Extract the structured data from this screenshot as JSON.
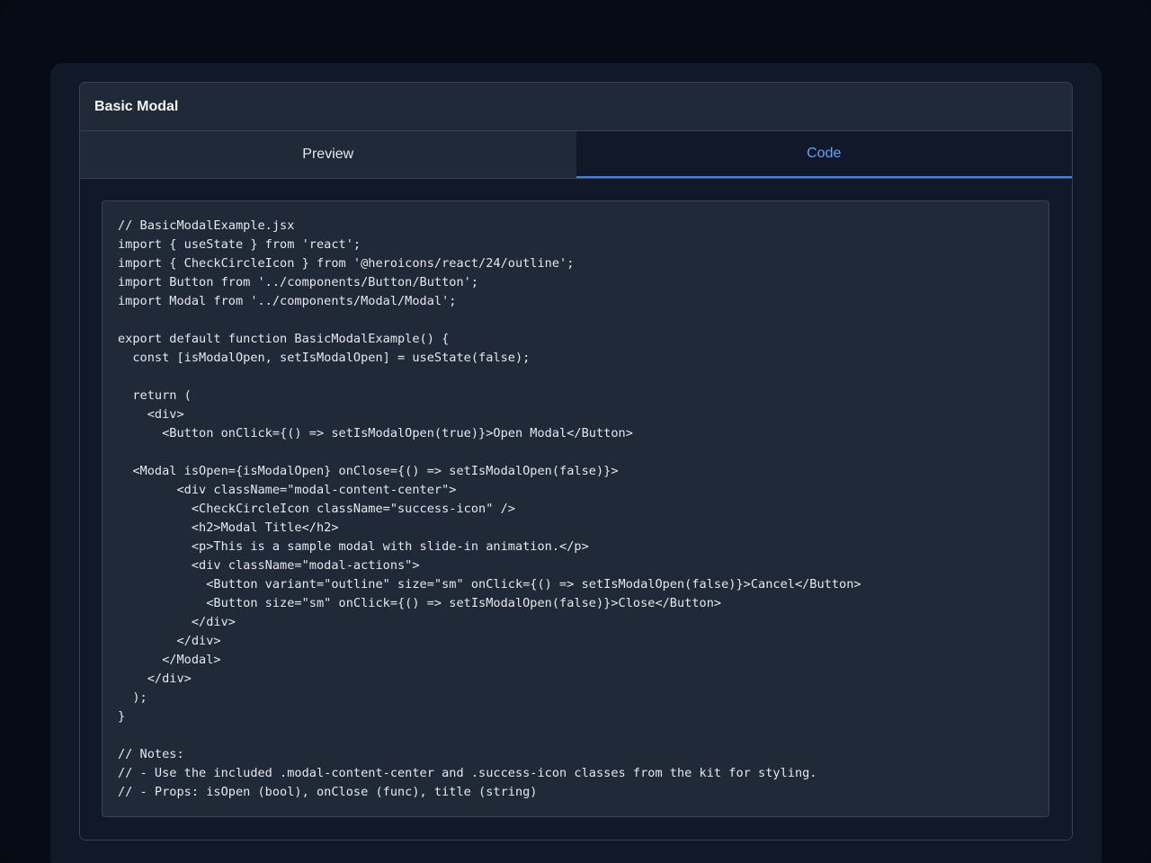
{
  "card": {
    "title": "Basic Modal"
  },
  "tabs": [
    {
      "label": "Preview",
      "active": false
    },
    {
      "label": "Code",
      "active": true
    }
  ],
  "code": {
    "language": "jsx",
    "text": "// BasicModalExample.jsx\nimport { useState } from 'react';\nimport { CheckCircleIcon } from '@heroicons/react/24/outline';\nimport Button from '../components/Button/Button';\nimport Modal from '../components/Modal/Modal';\n\nexport default function BasicModalExample() {\n  const [isModalOpen, setIsModalOpen] = useState(false);\n\n  return (\n    <div>\n      <Button onClick={() => setIsModalOpen(true)}>Open Modal</Button>\n\n  <Modal isOpen={isModalOpen} onClose={() => setIsModalOpen(false)}>\n        <div className=\"modal-content-center\">\n          <CheckCircleIcon className=\"success-icon\" />\n          <h2>Modal Title</h2>\n          <p>This is a sample modal with slide-in animation.</p>\n          <div className=\"modal-actions\">\n            <Button variant=\"outline\" size=\"sm\" onClick={() => setIsModalOpen(false)}>Cancel</Button>\n            <Button size=\"sm\" onClick={() => setIsModalOpen(false)}>Close</Button>\n          </div>\n        </div>\n      </Modal>\n    </div>\n  );\n}\n\n// Notes:\n// - Use the included .modal-content-center and .success-icon classes from the kit for styling.\n// - Props: isOpen (bool), onClose (func), title (string)"
  },
  "colors": {
    "accent": "#60a5fa",
    "active_tab_underline": "#3b82f6",
    "card_bg": "#1f2937",
    "code_bg": "#1f2937",
    "page_bg": "#050c16"
  }
}
